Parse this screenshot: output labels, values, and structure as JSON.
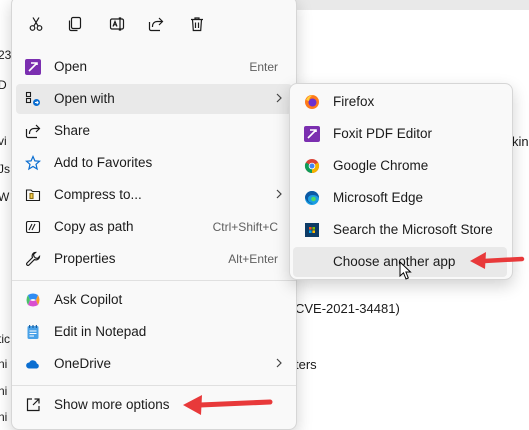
{
  "background": {
    "left_fragments": [
      "",
      "23",
      "D",
      "vi",
      "Js",
      "W",
      "",
      "",
      "",
      "",
      "tic",
      "ni",
      "",
      "ni",
      "ni"
    ],
    "right_fragments": {
      "kin": "kin",
      "cve": "CVE-2021-34481)",
      "ters": "ters"
    }
  },
  "toolbar": {
    "cut_icon": "scissors-icon",
    "copy_icon": "copy-icon",
    "rename_icon": "rename-icon",
    "share_icon": "share-icon",
    "delete_icon": "trash-icon"
  },
  "menu": {
    "open": {
      "label": "Open",
      "shortcut": "Enter",
      "icon": "foxit-icon"
    },
    "open_with": {
      "label": "Open with",
      "icon": "open-with-icon"
    },
    "share": {
      "label": "Share",
      "icon": "share-icon"
    },
    "favorites": {
      "label": "Add to Favorites",
      "icon": "star-icon"
    },
    "compress": {
      "label": "Compress to...",
      "icon": "zip-folder-icon"
    },
    "copy_path": {
      "label": "Copy as path",
      "shortcut": "Ctrl+Shift+C",
      "icon": "path-icon"
    },
    "properties": {
      "label": "Properties",
      "shortcut": "Alt+Enter",
      "icon": "wrench-icon"
    },
    "copilot": {
      "label": "Ask Copilot",
      "icon": "copilot-icon"
    },
    "notepad": {
      "label": "Edit in Notepad",
      "icon": "notepad-icon"
    },
    "onedrive": {
      "label": "OneDrive",
      "icon": "cloud-icon"
    },
    "more": {
      "label": "Show more options",
      "icon": "more-options-icon"
    }
  },
  "submenu": {
    "items": [
      {
        "label": "Firefox",
        "icon": "firefox-icon"
      },
      {
        "label": "Foxit PDF Editor",
        "icon": "foxit-icon"
      },
      {
        "label": "Google Chrome",
        "icon": "chrome-icon"
      },
      {
        "label": "Microsoft Edge",
        "icon": "edge-icon"
      },
      {
        "label": "Search the Microsoft Store",
        "icon": "store-icon"
      },
      {
        "label": "Choose another app",
        "icon": ""
      }
    ]
  },
  "colors": {
    "accent_red": "#e8393a",
    "highlight": "#e9e9e9",
    "menu_bg": "#f9f9f9"
  }
}
